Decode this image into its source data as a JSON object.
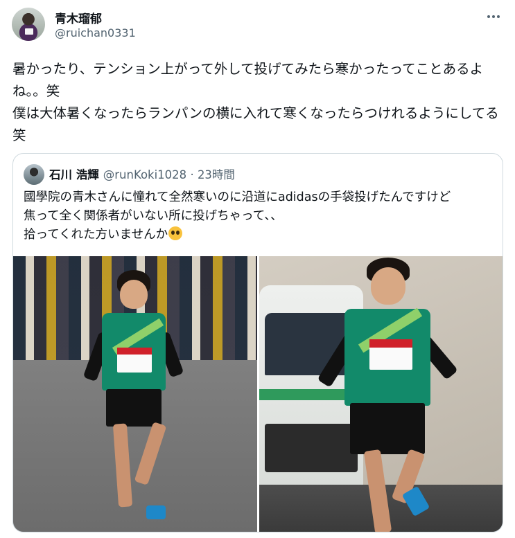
{
  "tweet": {
    "author": {
      "display_name": "青木瑠郁",
      "handle": "@ruichan0331"
    },
    "text": "暑かったり、テンション上がって外して投げてみたら寒かったってことあるよね。。笑\n僕は大体暑くなったらランパンの横に入れて寒くなったらつけれるようにしてる笑"
  },
  "quoted_tweet": {
    "author": {
      "display_name": "石川 浩輝",
      "handle": "@runKoki1028",
      "time_sep": "·",
      "time": "23時間"
    },
    "text": "國學院の青木さんに憧れて全然寒いのに沿道にadidasの手袋投げたんですけど\n焦って全く関係者がいない所に投げちゃって、、\n拾ってくれた方いませんか",
    "emoji": "pleading-face"
  },
  "colors": {
    "text_primary": "#0f1419",
    "text_secondary": "#536471",
    "border": "#cfd9de",
    "jersey_green": "#128a6a"
  },
  "icons": [
    "more-icon"
  ]
}
